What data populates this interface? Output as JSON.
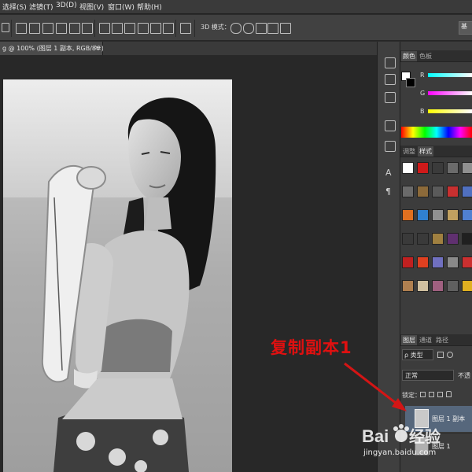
{
  "menubar": {
    "items": [
      "选择(S)",
      "滤镜(T)",
      "3D(D)",
      "视图(V)",
      "窗口(W)",
      "帮助(H)"
    ]
  },
  "options": {
    "mode_label": "3D 模式：",
    "right_button": "基"
  },
  "document": {
    "tab_title": "g @ 100% (图层 1 副本, RGB/8#) *",
    "close_glyph": "×"
  },
  "panels": {
    "color_tabs": [
      "颜色",
      "色板"
    ],
    "color_channels": [
      "R",
      "G",
      "B"
    ],
    "style_tabs": [
      "调整",
      "样式"
    ],
    "layer_tabs": [
      "图层",
      "通道",
      "路径"
    ],
    "kind_filter": "ρ 类型",
    "blend_mode": "正常",
    "opacity_label": "不透",
    "lock_label": "锁定：",
    "layers": [
      {
        "name": "图层 1 副本",
        "selected": true
      },
      {
        "name": "图层 1",
        "selected": false
      }
    ]
  },
  "annotation": {
    "text": "复制副本1",
    "color": "#e01010"
  },
  "watermark": {
    "brand": "Baidu经验",
    "url": "jingyan.baidu.com"
  },
  "colors": {
    "menubar_bg": "#3a3a3a",
    "options_bg": "#414141",
    "canvas_bg": "#282828",
    "panel_bg": "#3c3c3c",
    "layer_selected": "#56677c"
  }
}
